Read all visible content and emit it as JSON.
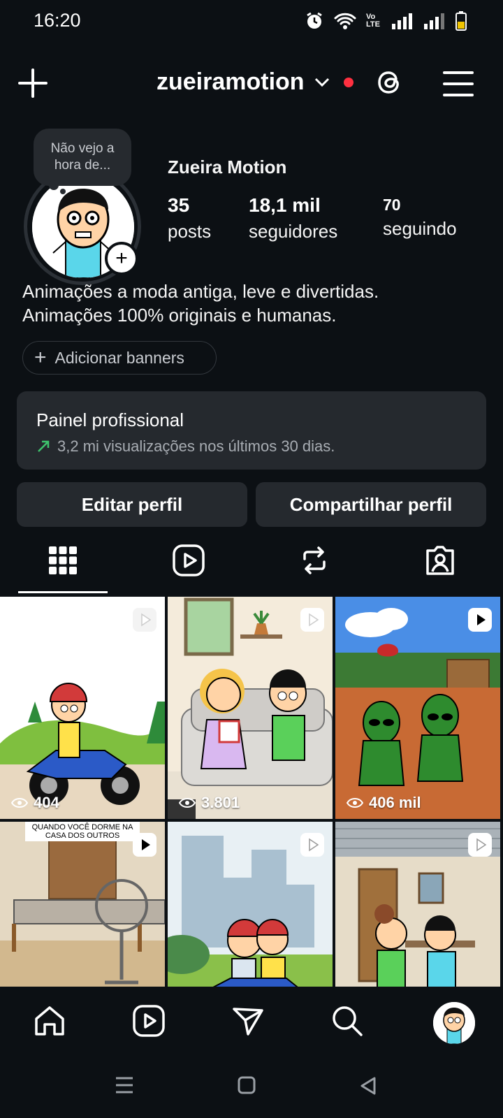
{
  "status_bar": {
    "time": "16:20",
    "network_label": "Vo LTE"
  },
  "header": {
    "username": "zueiramotion"
  },
  "profile": {
    "note": "Não vejo a hora de...",
    "display_name": "Zueira Motion",
    "stats": [
      {
        "value": "35",
        "label": "posts"
      },
      {
        "value": "18,1 mil",
        "label": "seguidores"
      },
      {
        "value": "70",
        "label": "seguindo"
      }
    ],
    "bio_lines": [
      "Animações a moda antiga, leve e divertidas.",
      "Animações 100% originais e humanas."
    ],
    "banner_button": "Adicionar banners"
  },
  "pro_panel": {
    "title": "Painel profissional",
    "subtitle": "3,2 mi visualizações nos últimos 30 dias."
  },
  "actions": {
    "edit": "Editar perfil",
    "share": "Compartilhar perfil"
  },
  "tabs": [
    "grid-icon",
    "reels-icon",
    "reposts-icon",
    "tagged-icon"
  ],
  "grid": [
    {
      "views": "404"
    },
    {
      "views": "3.801"
    },
    {
      "views": "406 mil"
    },
    {
      "overlay_text_line1": "QUANDO VOCÊ DORME NA",
      "overlay_text_line2": "CASA DOS OUTROS"
    },
    {},
    {}
  ],
  "colors": {
    "background": "#0c1014",
    "panel": "#25292e",
    "accent_red": "#ff3040",
    "trend_green": "#3ec46d"
  }
}
